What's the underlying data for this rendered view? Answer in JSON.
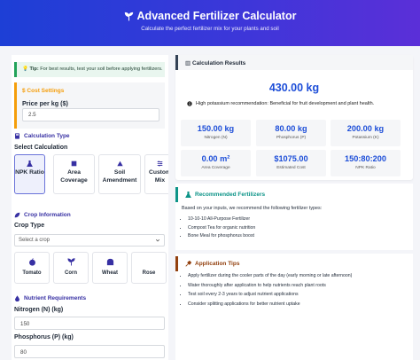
{
  "header": {
    "title": "Advanced Fertilizer Calculator",
    "subtitle": "Calculate the perfect fertilizer mix for your plants and soil"
  },
  "tip": {
    "label": "Tip:",
    "text": "For best results, test your soil before applying fertilizers."
  },
  "cost": {
    "heading": "$ Cost Settings",
    "price_label": "Price per kg ($)",
    "price_value": "2.5"
  },
  "calc_type": {
    "heading": "Calculation Type",
    "sub_label": "Select Calculation",
    "options": [
      {
        "label": "NPK Ratio",
        "icon": "flask-icon",
        "active": true
      },
      {
        "label": "Area Coverage",
        "icon": "area-icon",
        "active": false
      },
      {
        "label": "Soil Amendment",
        "icon": "mountain-icon",
        "active": false
      },
      {
        "label": "Custom Mix",
        "icon": "sliders-icon",
        "active": false
      }
    ]
  },
  "crop": {
    "heading": "Crop Information",
    "type_label": "Crop Type",
    "select_placeholder": "Select a crop",
    "options": [
      {
        "label": "Tomato",
        "icon": "apple-icon"
      },
      {
        "label": "Corn",
        "icon": "seedling-icon"
      },
      {
        "label": "Wheat",
        "icon": "bread-icon"
      },
      {
        "label": "Rose",
        "icon": "flower-icon"
      }
    ]
  },
  "nutrients": {
    "heading": "Nutrient Requirements",
    "nitrogen_label": "Nitrogen (N) (kg)",
    "nitrogen_value": "150",
    "phosphorus_label": "Phosphorus (P) (kg)",
    "phosphorus_value": "80"
  },
  "results": {
    "heading": "Calculation Results",
    "total": "430.00 kg",
    "recommendation": "High potassium recommendation: Beneficial for fruit development and plant health.",
    "stats": [
      {
        "value": "150.00 kg",
        "label": "Nitrogen (N)"
      },
      {
        "value": "80.00 kg",
        "label": "Phosphorus (P)"
      },
      {
        "value": "200.00 kg",
        "label": "Potassium (K)"
      },
      {
        "value": "0.00 m²",
        "label": "Area Coverage"
      },
      {
        "value": "$1075.00",
        "label": "Estimated Cost"
      },
      {
        "value": "150:80:200",
        "label": "NPK Ratio"
      }
    ]
  },
  "fertilizers": {
    "heading": "Recommended Fertilizers",
    "intro": "Based on your inputs, we recommend the following fertilizer types:",
    "items": [
      "10-10-10 All-Purpose Fertilizer",
      "Compost Tea for organic nutrition",
      "Bone Meal for phosphorus boost"
    ]
  },
  "tips": {
    "heading": "Application Tips",
    "items": [
      "Apply fertilizer during the cooler parts of the day (early morning or late afternoon)",
      "Water thoroughly after application to help nutrients reach plant roots",
      "Test soil every 2-3 years to adjust nutrient applications",
      "Consider splitting applications for better nutrient uptake"
    ]
  },
  "colors": {
    "primary": "#1d4ed8",
    "accent_orange": "#f59e0b",
    "teal": "#0d9488",
    "brown": "#92400e"
  }
}
